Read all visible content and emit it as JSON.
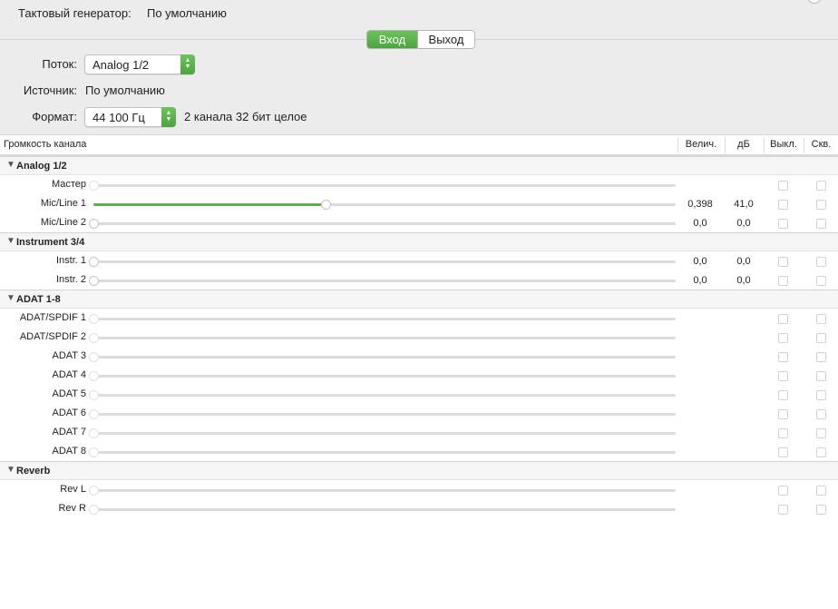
{
  "clock": {
    "label": "Тактовый генератор:",
    "value": "По умолчанию"
  },
  "direction_tabs": [
    {
      "label": "Вход",
      "active": true
    },
    {
      "label": "Выход",
      "active": false
    }
  ],
  "form": {
    "stream_label": "Поток:",
    "stream_value": "Analog 1/2",
    "source_label": "Источник:",
    "source_value": "По умолчанию",
    "format_label": "Формат:",
    "format_value": "44 100 Гц",
    "format_desc": "2 канала 32 бит целое"
  },
  "table": {
    "col_channel": "Громкость канала",
    "col_value": "Велич.",
    "col_db": "дБ",
    "col_mute": "Выкл.",
    "col_thru": "Скв."
  },
  "accent_color": "#5fb04c",
  "groups": [
    {
      "name": "Analog 1/2",
      "channels": [
        {
          "name": "Мастер",
          "level": 0,
          "value": "",
          "db": "",
          "enabled": false
        },
        {
          "name": "Mic/Line 1",
          "level": 0.398,
          "value": "0,398",
          "db": "41,0",
          "enabled": true
        },
        {
          "name": "Mic/Line 2",
          "level": 0,
          "value": "0,0",
          "db": "0,0",
          "enabled": true
        }
      ]
    },
    {
      "name": "Instrument 3/4",
      "channels": [
        {
          "name": "Instr. 1",
          "level": 0,
          "value": "0,0",
          "db": "0,0",
          "enabled": true
        },
        {
          "name": "Instr. 2",
          "level": 0,
          "value": "0,0",
          "db": "0,0",
          "enabled": true
        }
      ]
    },
    {
      "name": "ADAT 1-8",
      "channels": [
        {
          "name": "ADAT/SPDIF 1",
          "level": 0,
          "value": "",
          "db": "",
          "enabled": false
        },
        {
          "name": "ADAT/SPDIF 2",
          "level": 0,
          "value": "",
          "db": "",
          "enabled": false
        },
        {
          "name": "ADAT 3",
          "level": 0,
          "value": "",
          "db": "",
          "enabled": false
        },
        {
          "name": "ADAT 4",
          "level": 0,
          "value": "",
          "db": "",
          "enabled": false
        },
        {
          "name": "ADAT 5",
          "level": 0,
          "value": "",
          "db": "",
          "enabled": false
        },
        {
          "name": "ADAT 6",
          "level": 0,
          "value": "",
          "db": "",
          "enabled": false
        },
        {
          "name": "ADAT 7",
          "level": 0,
          "value": "",
          "db": "",
          "enabled": false
        },
        {
          "name": "ADAT 8",
          "level": 0,
          "value": "",
          "db": "",
          "enabled": false
        }
      ]
    },
    {
      "name": "Reverb",
      "channels": [
        {
          "name": "Rev L",
          "level": 0,
          "value": "",
          "db": "",
          "enabled": false
        },
        {
          "name": "Rev R",
          "level": 0,
          "value": "",
          "db": "",
          "enabled": false
        }
      ]
    }
  ]
}
